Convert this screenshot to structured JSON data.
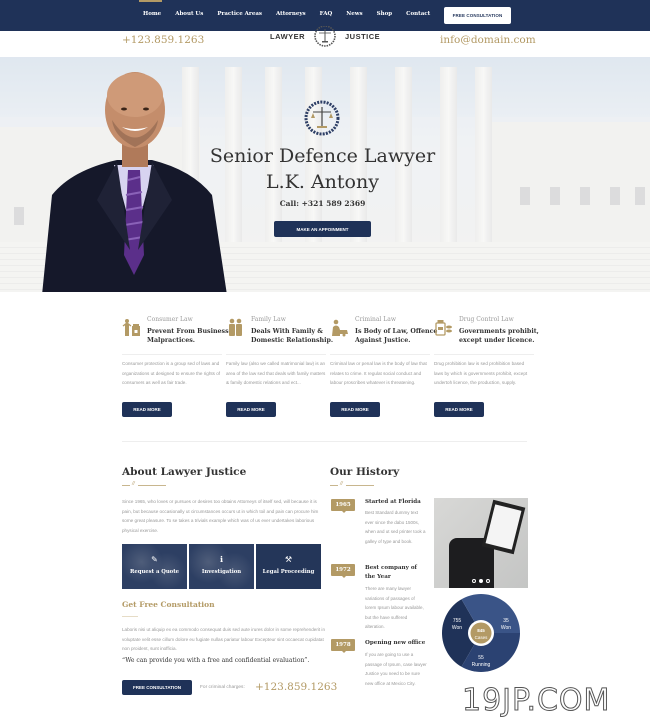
{
  "nav": {
    "items": [
      {
        "label": "Home",
        "active": true
      },
      {
        "label": "About Us"
      },
      {
        "label": "Practice Areas"
      },
      {
        "label": "Attorneys"
      },
      {
        "label": "FAQ"
      },
      {
        "label": "News"
      },
      {
        "label": "Shop"
      },
      {
        "label": "Contact"
      }
    ],
    "cta": "FREE CONSULTATION"
  },
  "topbar": {
    "phone": "+123.859.1263",
    "email": "info@domain.com",
    "logo_left": "LAWYER",
    "logo_right": "JUSTICE"
  },
  "hero": {
    "title_line1": "Senior Defence Lawyer",
    "title_line2": "L.K. Antony",
    "call": "Call: +321 589 2369",
    "button": "MAKE AN APPOINMENT"
  },
  "services": [
    {
      "category": "Consumer Law",
      "title": "Prevent From Business Malpractices.",
      "text": "Consumer protection is a group sed of laws and organizations ut designed to ensure the rights of consumers as well as fair trade.",
      "button": "READ MORE",
      "icon": "consumer-icon"
    },
    {
      "category": "Family Law",
      "title": "Deals With Family & Domestic Relationship.",
      "text": "Family law (also we called matrimonial law) is an area of the law sed that deals with family matters & family domestic relations and ect...",
      "button": "READ MORE",
      "icon": "family-icon"
    },
    {
      "category": "Criminal Law",
      "title": "Is Body of Law, Offence Against Justice.",
      "text": "Criminal law or penal law is the body of law that relates to crime. It regulat social conduct and labour proscribes whatever is threatening.",
      "button": "READ MORE",
      "icon": "criminal-icon"
    },
    {
      "category": "Drug Control Law",
      "title": "Governments prohibit, except under licence.",
      "text": "Drug prohibition law is sed prohibition based laws by which is governments prohibit, except undertoh licence, the production, supply.",
      "button": "READ MORE",
      "icon": "drug-icon"
    }
  ],
  "about": {
    "title": "About Lawyer Justice",
    "separator": "//",
    "text": "Since 1965, who loves or pursues or desires too obtains Attorneys of itself sed, will because it is pain, but because occasionally ut circumstances occurs ut in which toil and pain can procure him some great pleasure. To se takes a trivials example which was of us ever undertakes laborious physical exercise.",
    "features": [
      {
        "label": "Request a Quote",
        "icon": "edit-icon"
      },
      {
        "label": "Investigation",
        "icon": "info-icon"
      },
      {
        "label": "Legal Proceeding",
        "icon": "gavel-icon"
      }
    ]
  },
  "consultation": {
    "title": "Get Free Consultation",
    "text": "Laboris nisi ut aliquip ex ea commodo consequat duis sed aute irures dolor in some reprehenderit in voluptate velit esse cillum dolore eu fugiate nullas pariatur labour Excepteur sint occaecat cupidatat non proident, sunt inofficia.",
    "quote": "“We can provide you with a free and confidential evaluation”.",
    "button": "FREE CONSULTATION",
    "label": "For criminal charges:",
    "phone": "+123.859.1263"
  },
  "history": {
    "title": "Our History",
    "separator": "//",
    "items": [
      {
        "year": "1965",
        "title": "Started at Florida",
        "text": "Best Standard dummy text ever since the dabo 1500s, when and ut sed printer took a galley of type and book."
      },
      {
        "year": "1972",
        "title": "Best company of the Year",
        "text": "There are many lawyer variations of passages of lorem Ipsum labour available, but the have suffered alteration."
      },
      {
        "year": "1978",
        "title": "Opening new office",
        "text": "If you are going to use a passage of Ipsum, case lawyer Justice you need to be sure new office at Mexico City."
      }
    ]
  },
  "slider": {
    "slides": 3,
    "active": 2
  },
  "stats": {
    "center_value": "845",
    "center_label": "Cases",
    "segments": [
      {
        "value": "755",
        "label": "Won",
        "color": "#1f3258"
      },
      {
        "value": "35",
        "label": "Won",
        "color": "#3a5487"
      },
      {
        "value": "55",
        "label": "Running",
        "color": "#2b4272"
      }
    ],
    "center_color": "#b39a65"
  },
  "watermark": "19JP.COM",
  "colors": {
    "navy": "#1f3258",
    "gold": "#b39a65"
  }
}
